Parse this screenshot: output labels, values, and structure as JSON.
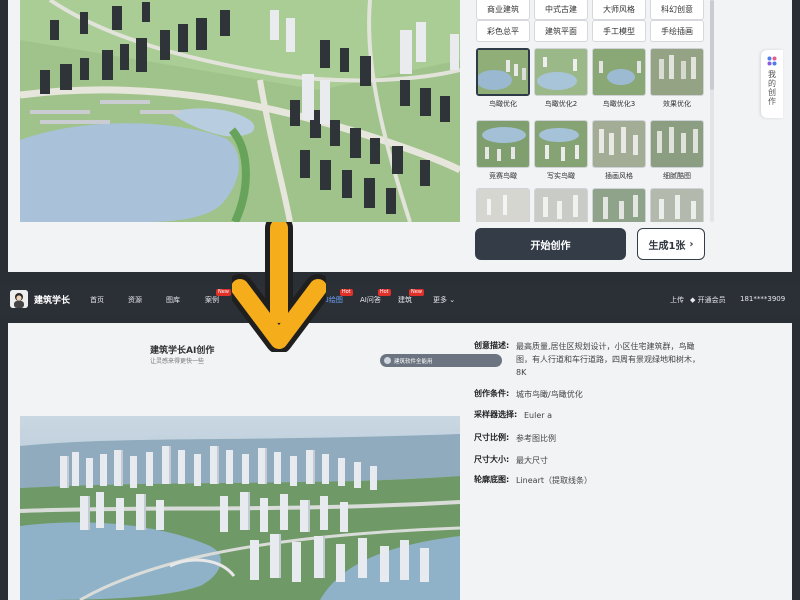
{
  "top": {
    "chips": [
      "商业建筑",
      "中式古建",
      "大师风格",
      "科幻创意",
      "彩色总平",
      "建筑平面",
      "手工模型",
      "手绘插画"
    ],
    "styles": [
      {
        "label": "鸟瞰优化",
        "selected": true
      },
      {
        "label": "鸟瞰优化2",
        "selected": false
      },
      {
        "label": "鸟瞰优化3",
        "selected": false
      },
      {
        "label": "效果优化",
        "selected": false
      },
      {
        "label": "竞赛鸟瞰",
        "selected": false
      },
      {
        "label": "写实鸟瞰",
        "selected": false
      },
      {
        "label": "插画风格",
        "selected": false
      },
      {
        "label": "细腻酷图",
        "selected": false
      },
      {
        "label": "",
        "selected": false
      },
      {
        "label": "",
        "selected": false
      },
      {
        "label": "",
        "selected": false
      },
      {
        "label": "",
        "selected": false
      }
    ],
    "start_label": "开始创作",
    "generate_label": "生成1张",
    "side_tab_label": "我的创作"
  },
  "nav": {
    "brand": "建筑学长",
    "items": [
      {
        "label": "首页",
        "badge": ""
      },
      {
        "label": "资源",
        "badge": ""
      },
      {
        "label": "图库",
        "badge": ""
      },
      {
        "label": "案例",
        "badge": "New"
      },
      {
        "label": "AI绘图",
        "badge": "Hot"
      },
      {
        "label": "AI问答",
        "badge": "Hot"
      },
      {
        "label": "建筑",
        "badge": "New"
      },
      {
        "label": "更多",
        "badge": ""
      }
    ],
    "upload": "上传",
    "vip": "开通会员",
    "user": "181****3909"
  },
  "card": {
    "title": "建筑学长AI创作",
    "subtitle": "让灵感来得更快一些",
    "pill": "建筑软件全能用"
  },
  "details": [
    {
      "key": "创意描述:",
      "value": "最高质量,居住区规划设计，小区住宅建筑群，鸟瞰图，有人行道和车行道路，四周有景观绿地和树木，8K"
    },
    {
      "key": "创作条件:",
      "value": "城市鸟瞰/鸟瞰优化"
    },
    {
      "key": "采样器选择:",
      "value": "Euler a"
    },
    {
      "key": "尺寸比例:",
      "value": "参考图比例"
    },
    {
      "key": "尺寸大小:",
      "value": "最大尺寸"
    },
    {
      "key": "轮廓底图:",
      "value": "Lineart（提取线条）"
    }
  ],
  "colors": {
    "arrow": "#f5ad1b",
    "dark_button": "#343c48",
    "nav_bg": "#2b2f36",
    "active_nav": "#6ea6ff"
  }
}
